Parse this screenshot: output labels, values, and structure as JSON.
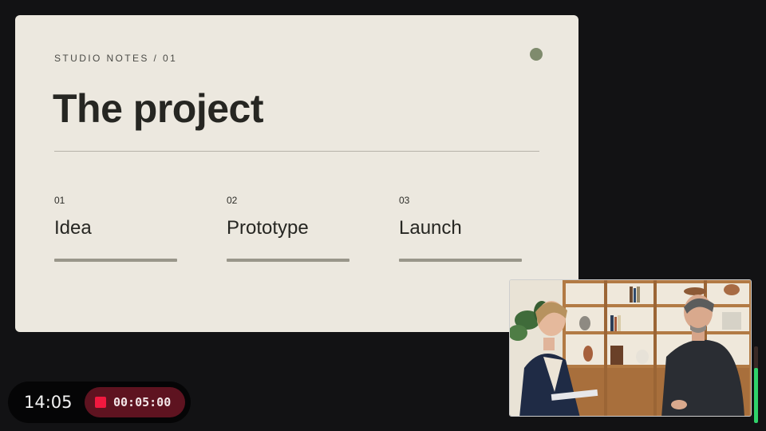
{
  "slide": {
    "eyebrow": "STUDIO NOTES / 01",
    "title": "The project",
    "accent_color": "#7f8b6d",
    "steps": [
      {
        "num": "01",
        "label": "Idea"
      },
      {
        "num": "02",
        "label": "Prototype"
      },
      {
        "num": "03",
        "label": "Launch"
      }
    ]
  },
  "video": {
    "description_icon": "participant-video-feed"
  },
  "audio_meter": {
    "level": 0.72,
    "color": "#2fd36a"
  },
  "recording": {
    "clock": "14:05",
    "elapsed": "00:05:00",
    "icon": "stop-record-icon",
    "color": "#f0193f"
  }
}
